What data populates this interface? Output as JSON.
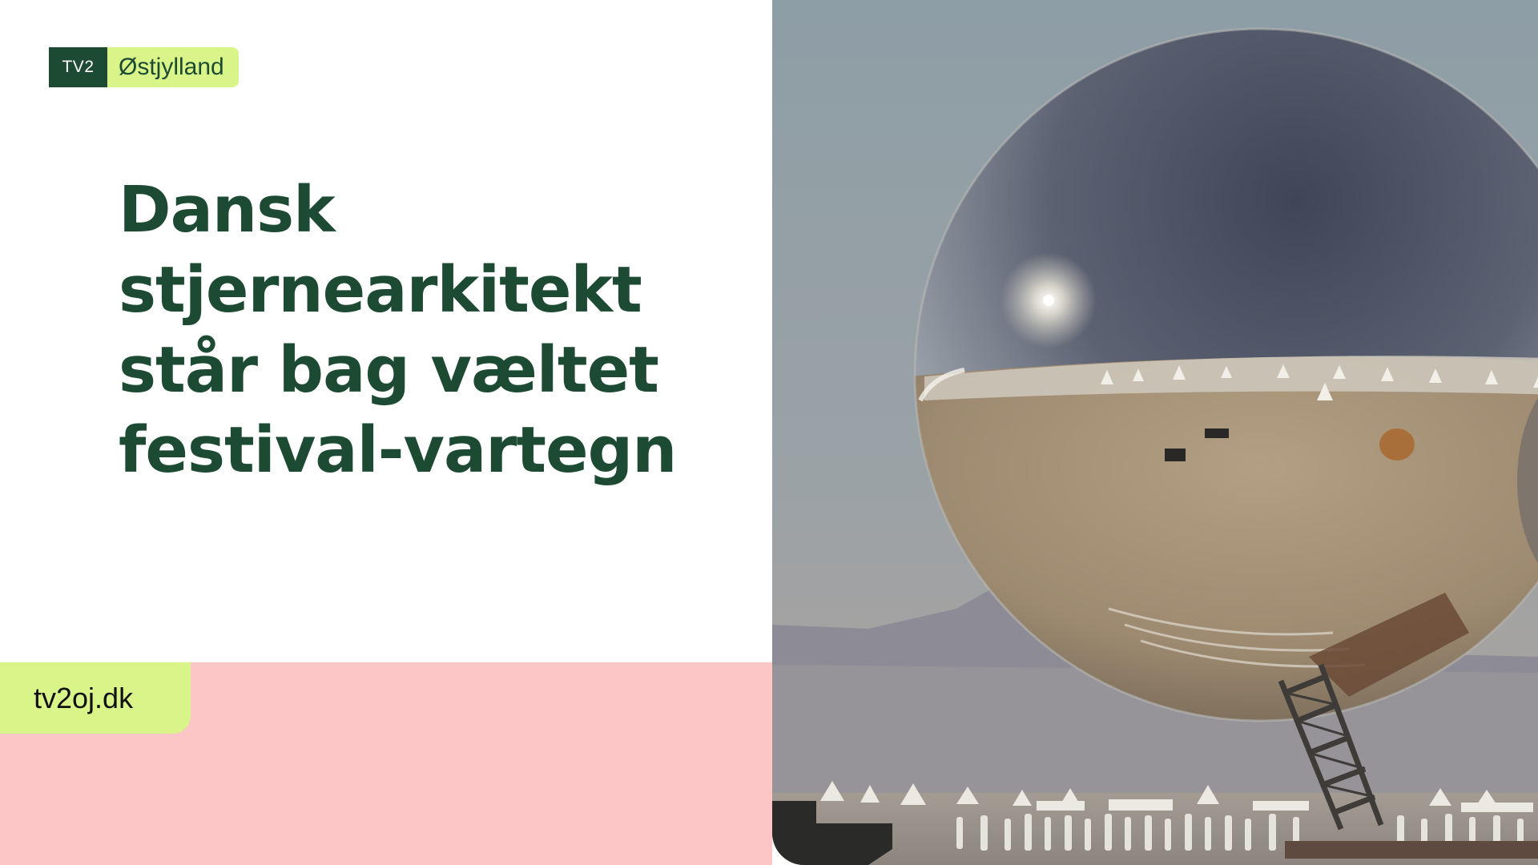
{
  "logo": {
    "brand": "TV2",
    "region": "Østjylland"
  },
  "headline": [
    "Dansk",
    "stjernearkitekt",
    "står bag væltet",
    "festival-vartegn"
  ],
  "site_url": "tv2oj.dk",
  "colors": {
    "brand_green": "#1d4a32",
    "lime_accent": "#d9f58a",
    "pink_band": "#fcc5c6",
    "background": "#ffffff"
  },
  "photo": {
    "subject": "mirrored-sphere-sculpture"
  }
}
